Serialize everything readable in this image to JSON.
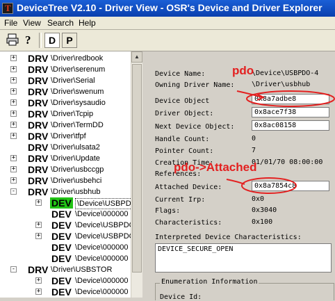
{
  "window": {
    "title": "DeviceTree V2.10 - Driver View - OSR's Device and Driver Explorer"
  },
  "menu": [
    "File",
    "View",
    "Search",
    "Help"
  ],
  "toolbar": {
    "d_label": "D",
    "p_label": "P"
  },
  "tree": [
    {
      "badge": "DRV",
      "name": "\\Driver\\redbook"
    },
    {
      "badge": "DRV",
      "name": "\\Driver\\serenum"
    },
    {
      "badge": "DRV",
      "name": "\\Driver\\Serial"
    },
    {
      "badge": "DRV",
      "name": "\\Driver\\swenum"
    },
    {
      "badge": "DRV",
      "name": "\\Driver\\sysaudio"
    },
    {
      "badge": "DRV",
      "name": "\\Driver\\Tcpip"
    },
    {
      "badge": "DRV",
      "name": "\\Driver\\TermDD"
    },
    {
      "badge": "DRV",
      "name": "\\Driver\\tfpf"
    },
    {
      "badge": "DRV",
      "name": "\\Driver\\ulsata2"
    },
    {
      "badge": "DRV",
      "name": "\\Driver\\Update"
    },
    {
      "badge": "DRV",
      "name": "\\Driver\\usbccgp"
    },
    {
      "badge": "DRV",
      "name": "\\Driver\\usbehci"
    },
    {
      "badge": "DRV",
      "name": "\\Driver\\usbhub"
    },
    {
      "badge": "DEV",
      "name": "\\Device\\USBPDO"
    },
    {
      "badge": "DEV",
      "name": "\\Device\\000000"
    },
    {
      "badge": "DEV",
      "name": "\\Device\\USBPDO"
    },
    {
      "badge": "DEV",
      "name": "\\Device\\USBPDO"
    },
    {
      "badge": "DEV",
      "name": "\\Device\\000000"
    },
    {
      "badge": "DEV",
      "name": "\\Device\\000000"
    },
    {
      "badge": "DRV",
      "name": "\\Driver\\USBSTOR"
    },
    {
      "badge": "DEV",
      "name": "\\Device\\000000"
    },
    {
      "badge": "DEV",
      "name": "\\Device\\000000"
    }
  ],
  "props": {
    "device_name": {
      "label": "Device Name:",
      "value": "\\Device\\USBPDO-4"
    },
    "owning_driver": {
      "label": "Owning Driver Name:",
      "value": "\\Driver\\usbhub"
    },
    "device_object": {
      "label": "Device Object",
      "value": "0x8a7adbe8"
    },
    "driver_object": {
      "label": "Driver Object:",
      "value": "0x8ace7f38"
    },
    "next_device": {
      "label": "Next Device Object:",
      "value": "0x8ac08158"
    },
    "handle_count": {
      "label": "Handle Count:",
      "value": "0"
    },
    "pointer_count": {
      "label": "Pointer Count:",
      "value": "7"
    },
    "creation_time": {
      "label": "Creation Time:",
      "value": "01/01/70 08:00:00"
    },
    "references": {
      "label": "References:",
      "value": ""
    },
    "attached_device": {
      "label": "Attached Device:",
      "value": "0x8a7854c8"
    },
    "current_irp": {
      "label": "Current Irp:",
      "value": "0x0"
    },
    "flags": {
      "label": "Flags:",
      "value": "0x3040"
    },
    "characteristics": {
      "label": "Characteristics:",
      "value": "0x100"
    },
    "interpreted_label": "Interpreted Device Characteristics:",
    "interpreted_value": "DEVICE_SECURE_OPEN",
    "enumeration_title": "Enumeration Information",
    "device_id_label": "Device Id:"
  },
  "annotations": {
    "pdo": "pdo",
    "pdo_attached": "pdo->Attached"
  },
  "colors": {
    "highlight": "#22c316",
    "annotation": "#e32020",
    "titlebar": "#0a3fae"
  }
}
